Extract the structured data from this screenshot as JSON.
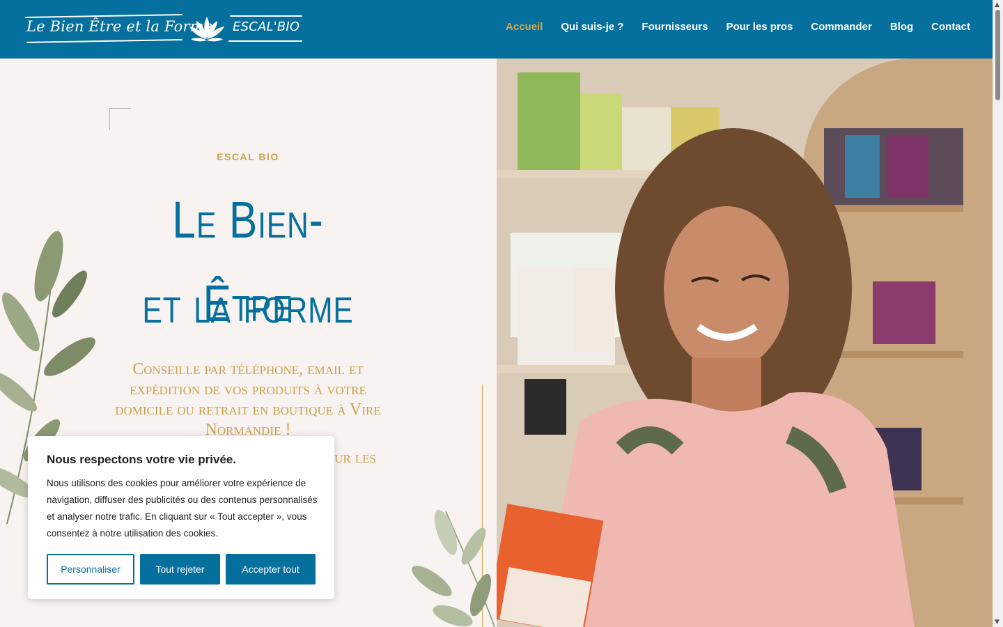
{
  "header": {
    "logo_left": "Le Bien Être et la Forme",
    "logo_right": "ESCAL'BIO",
    "nav": [
      {
        "label": "Accueil",
        "active": true
      },
      {
        "label": "Qui suis-je ?",
        "active": false
      },
      {
        "label": "Fournisseurs",
        "active": false
      },
      {
        "label": "Pour les pros",
        "active": false
      },
      {
        "label": "Commander",
        "active": false
      },
      {
        "label": "Blog",
        "active": false
      },
      {
        "label": "Contact",
        "active": false
      }
    ]
  },
  "hero": {
    "kicker": "ESCAL BIO",
    "title_line1": "Le Bien-Être",
    "title_line2": "et la forme",
    "subtitle": "Conseille par téléphone, email et expédition de vos produits à votre domicile ou retrait en boutique à Vire Normandie !",
    "subtitle2": "our les"
  },
  "cookie": {
    "title": "Nous respectons votre vie privée.",
    "text": "Nous utilisons des cookies pour améliorer votre expérience de navigation, diffuser des publicités ou des contenus personnalisés et analyser notre trafic. En cliquant sur « Tout accepter », vous consentez à notre utilisation des cookies.",
    "customize_label": "Personnaliser",
    "reject_label": "Tout rejeter",
    "accept_label": "Accepter tout"
  },
  "colors": {
    "brand_blue": "#05709e",
    "gold": "#c9a24e",
    "background": "#f8f3f1"
  },
  "icons": {
    "logo": "lotus-icon",
    "leaves": "leaf-decoration"
  }
}
